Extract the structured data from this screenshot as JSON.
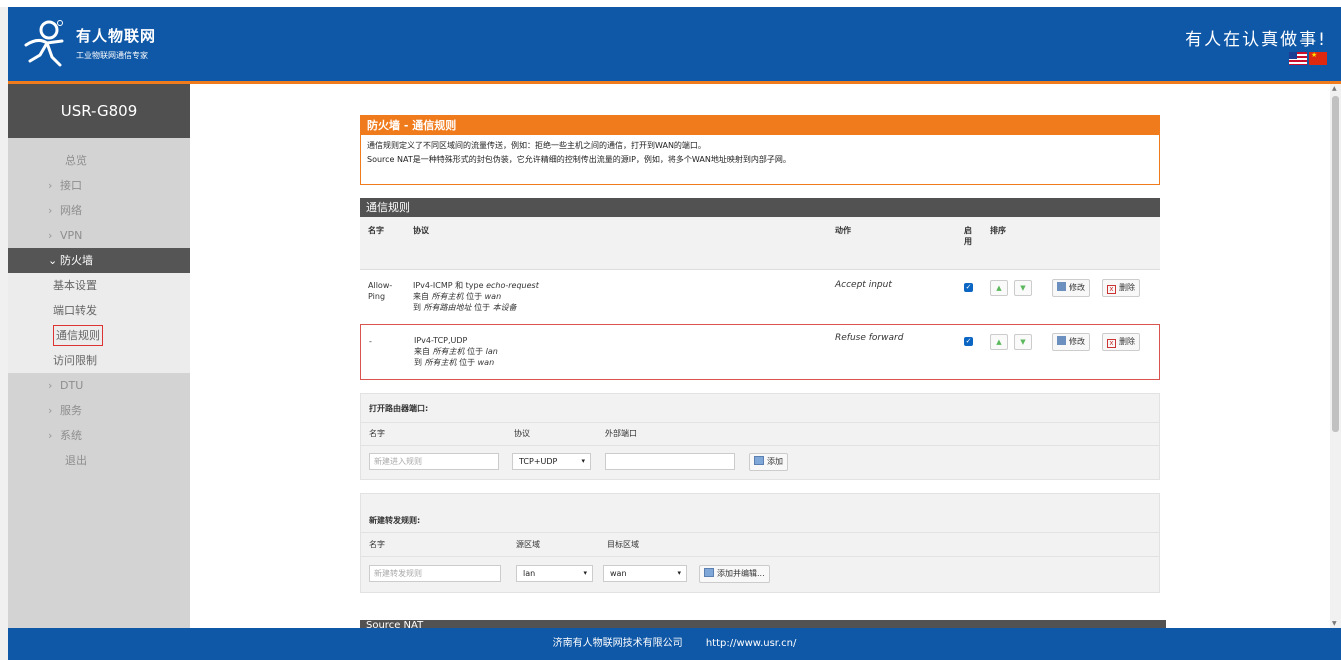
{
  "header": {
    "brand_name": "有人物联网",
    "brand_sub": "工业物联网通信专家",
    "slogan": "有人在认真做事!"
  },
  "sidebar": {
    "device": "USR-G809",
    "items": [
      {
        "label": "总览"
      },
      {
        "label": "接口"
      },
      {
        "label": "网络"
      },
      {
        "label": "VPN"
      },
      {
        "label": "防火墙"
      },
      {
        "label": "基本设置"
      },
      {
        "label": "端口转发"
      },
      {
        "label": "通信规则"
      },
      {
        "label": "访问限制"
      },
      {
        "label": "DTU"
      },
      {
        "label": "服务"
      },
      {
        "label": "系统"
      },
      {
        "label": "退出"
      }
    ]
  },
  "intro": {
    "title": "防火墙 - 通信规则",
    "line1": "通信规则定义了不同区域间的流量传送，例如：拒绝一些主机之间的通信，打开到WAN的端口。",
    "line2": "Source NAT是一种特殊形式的封包伪装，它允许精细的控制传出流量的源IP，例如，将多个WAN地址映射到内部子网。"
  },
  "rules": {
    "title": "通信规则",
    "columns": {
      "name": "名字",
      "protocol": "协议",
      "action": "动作",
      "enabled_1": "启",
      "enabled_2": "用",
      "sort": "排序"
    },
    "rows": [
      {
        "name_1": "Allow-",
        "name_2": "Ping",
        "proto": "IPv4-ICMP 和 type",
        "proto_type": "echo-request",
        "from_prefix": "来自",
        "from_host": "所有主机",
        "from_mid": "位于",
        "from_zone": "wan",
        "to_prefix": "到",
        "to_host": "所有路由地址",
        "to_mid": "位于",
        "to_zone": "本设备",
        "action": "Accept input",
        "enabled": true
      },
      {
        "name_1": "-",
        "name_2": "",
        "proto": "IPv4-TCP,UDP",
        "proto_type": "",
        "from_prefix": "来自",
        "from_host": "所有主机",
        "from_mid": "位于",
        "from_zone": "lan",
        "to_prefix": "到",
        "to_host": "所有主机",
        "to_mid": "位于",
        "to_zone": "wan",
        "action": "Refuse forward",
        "enabled": true
      }
    ],
    "check_mark": "✓",
    "move_up": "▲",
    "move_down": "▼",
    "edit_label": "修改",
    "delete_label": "删除",
    "delete_icon_glyph": "x"
  },
  "open_port": {
    "title": "打开路由器端口:",
    "name_label": "名字",
    "protocol_label": "协议",
    "ext_port_label": "外部端口",
    "name_placeholder": "新建进入规则",
    "protocol_value": "TCP+UDP",
    "ext_port_value": "",
    "add_label": "添加"
  },
  "forward": {
    "title": "新建转发规则:",
    "name_label": "名字",
    "src_label": "源区域",
    "dst_label": "目标区域",
    "name_placeholder": "新建转发规则",
    "src_value": "lan",
    "dst_value": "wan",
    "add_label": "添加并编辑..."
  },
  "snat": {
    "title": "Source NAT"
  },
  "footer": {
    "company": "济南有人物联网技术有限公司",
    "url": "http://www.usr.cn/"
  },
  "caret_glyph": "▾",
  "scroll_up": "▲",
  "scroll_down": "▼"
}
